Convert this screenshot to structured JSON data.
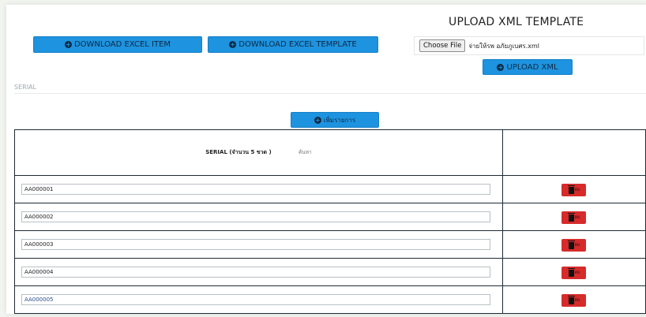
{
  "header": {
    "download_item_label": "DOWNLOAD EXCEL ITEM",
    "download_template_label": "DOWNLOAD EXCEL TEMPLATE",
    "upload_title": "UPLOAD XML TEMPLATE",
    "choose_file_label": "Choose File",
    "chosen_file_name": "จ่ายให้รพ อภัยภูเบศร.xml",
    "upload_xml_label": "UPLOAD XML"
  },
  "serial_section": {
    "label": "SERIAL",
    "add_item_label": "เพิ่มรายการ"
  },
  "table": {
    "header_text": "SERIAL (จำนวน 5 ขวด )",
    "search_text": "ค้นหา",
    "delete_label": "ลบ",
    "rows": [
      {
        "serial": "AA000001"
      },
      {
        "serial": "AA000002"
      },
      {
        "serial": "AA000003"
      },
      {
        "serial": "AA000004"
      },
      {
        "serial": "AA000005"
      }
    ]
  },
  "colors": {
    "primary": "#1e93df",
    "danger": "#d72b2b",
    "border": "#1d2b34"
  },
  "icons": {
    "plus": "plus-circle-icon",
    "delete": "trash-icon"
  }
}
